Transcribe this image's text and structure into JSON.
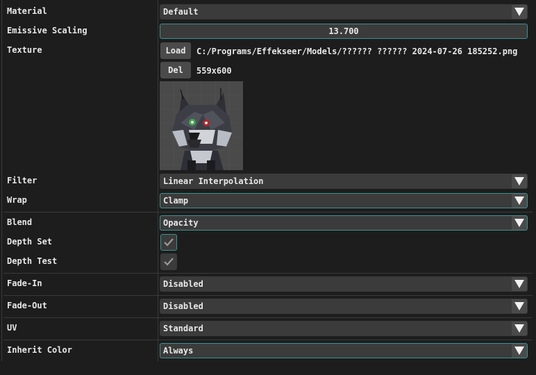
{
  "properties": {
    "material": {
      "label": "Material",
      "value": "Default"
    },
    "emissive": {
      "label": "Emissive Scaling",
      "value": "13.700"
    },
    "texture": {
      "label": "Texture",
      "load_label": "Load",
      "path": "C:/Programs/Effekseer/Models/?????? ?????? 2024-07-26 185252.png",
      "del_label": "Del",
      "size": "559x600",
      "thumbnail_icon": "wolf-texture-thumbnail"
    },
    "filter": {
      "label": "Filter",
      "value": "Linear Interpolation"
    },
    "wrap": {
      "label": "Wrap",
      "value": "Clamp"
    },
    "blend": {
      "label": "Blend",
      "value": "Opacity"
    },
    "depth_set": {
      "label": "Depth Set",
      "checked": true
    },
    "depth_test": {
      "label": "Depth Test",
      "checked": true
    },
    "fade_in": {
      "label": "Fade-In",
      "value": "Disabled"
    },
    "fade_out": {
      "label": "Fade-Out",
      "value": "Disabled"
    },
    "uv": {
      "label": "UV",
      "value": "Standard"
    },
    "inherit_color": {
      "label": "Inherit Color",
      "value": "Always"
    }
  },
  "colors": {
    "background": "#1d1d1d",
    "field": "#3b3b3b",
    "button": "#4a4a4a",
    "focus_border": "#3f8f8f"
  }
}
